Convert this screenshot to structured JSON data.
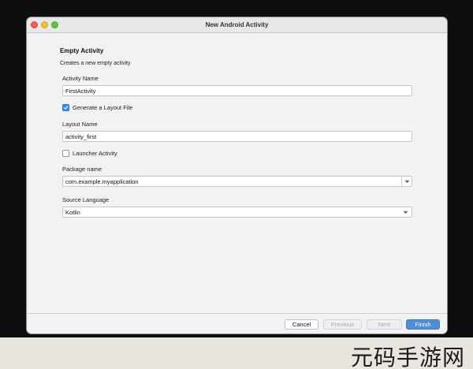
{
  "window": {
    "title": "New Android Activity"
  },
  "form": {
    "heading": "Empty Activity",
    "description": "Creates a new empty activity",
    "activity_name_label": "Activity Name",
    "activity_name_value": "FirstActivity",
    "generate_layout_label": "Generate a Layout File",
    "generate_layout_checked": true,
    "layout_name_label": "Layout Name",
    "layout_name_value": "activity_first",
    "launcher_activity_label": "Launcher Activity",
    "launcher_activity_checked": false,
    "package_name_label": "Package name",
    "package_name_value": "com.example.myapplication",
    "source_language_label": "Source Language",
    "source_language_value": "Kotlin"
  },
  "footer": {
    "cancel": "Cancel",
    "previous": "Previous",
    "next": "Next",
    "finish": "Finish"
  },
  "watermark": {
    "text": "元码手游网"
  },
  "colors": {
    "accent": "#4f8ed6",
    "checkbox": "#3d8af5"
  },
  "icons": [
    "close-dot",
    "minimize-dot",
    "zoom-dot",
    "checkmark-icon",
    "chevron-down-icon"
  ]
}
